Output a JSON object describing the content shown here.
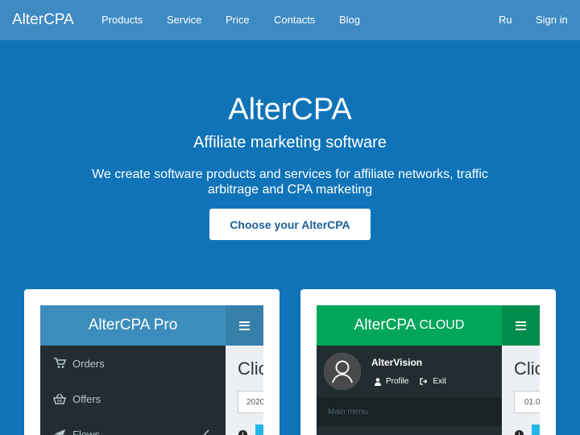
{
  "nav": {
    "brand": "AlterCPA",
    "links": [
      "Products",
      "Service",
      "Price",
      "Contacts",
      "Blog"
    ],
    "lang": "Ru",
    "signin": "Sign in"
  },
  "hero": {
    "title": "AlterCPA",
    "subtitle": "Affiliate marketing software",
    "description": "We create software products and services for affiliate networks, traffic arbitrage and CPA marketing",
    "cta": "Choose your AlterCPA"
  },
  "cards": {
    "pro": {
      "logo": "AlterCPA Pro",
      "menu": [
        "Orders",
        "Offers",
        "Flows"
      ],
      "content_title": "Clic",
      "input_value": "2020",
      "header_color": "#3c8dbc",
      "toggle_color": "#367fa9"
    },
    "cloud": {
      "logo_main": "AlterCPA",
      "logo_small": "CLOUD",
      "user_name": "AlterVision",
      "profile": "Profile",
      "exit": "Exit",
      "menu_header": "Main menu",
      "content_title": "Clic",
      "input_value": "01.0",
      "header_color": "#00a65a",
      "toggle_color": "#008d4c"
    }
  },
  "colors": {
    "background": "#0f73b8",
    "navbar": "#3e8ac2",
    "cta_text": "#1a5f96"
  }
}
